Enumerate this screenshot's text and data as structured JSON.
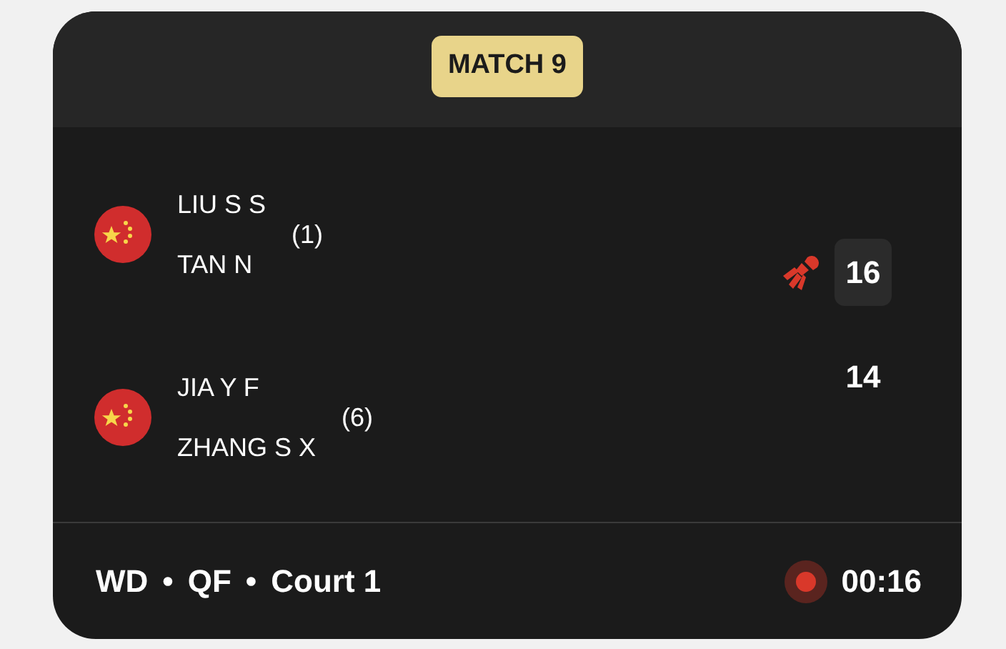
{
  "header": {
    "badge": "MATCH 9"
  },
  "teams": [
    {
      "flag": {
        "kind": "china"
      },
      "players": [
        "LIU S S",
        "TAN N"
      ],
      "seed": "(1)",
      "serving": true,
      "score": "16",
      "leading": true
    },
    {
      "flag": {
        "kind": "china"
      },
      "players": [
        "JIA Y F",
        "ZHANG S X"
      ],
      "seed": "(6)",
      "serving": false,
      "score": "14",
      "leading": false
    }
  ],
  "footer": {
    "event": "WD",
    "separator_1": "•",
    "round": "QF",
    "separator_2": "•",
    "court": "Court 1",
    "live": true,
    "time": "00:16"
  }
}
